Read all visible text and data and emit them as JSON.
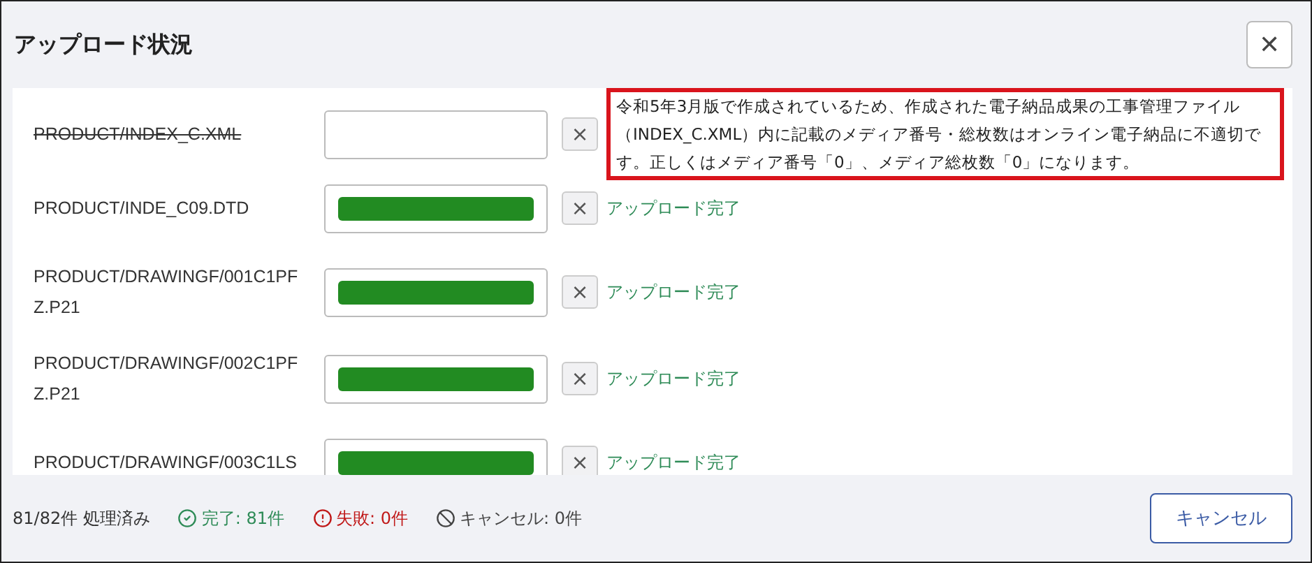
{
  "dialog": {
    "title": "アップロード状況",
    "close_label": "✕"
  },
  "files": [
    {
      "kind": "error",
      "name": "PRODUCT/INDEX_C.XML",
      "struck": true,
      "cancel_label": "×",
      "message": "令和5年3月版で作成されているため、作成された電子納品成果の工事管理ファイル（INDEX_C.XML）内に記載のメディア番号・総枚数はオンライン電子納品に不適切です。正しくはメディア番号「0」、メディア総枚数「0」になります。"
    },
    {
      "kind": "done",
      "name": "PRODUCT/INDE_C09.DTD",
      "struck": false,
      "cancel_label": "×",
      "message": "アップロード完了"
    },
    {
      "kind": "done",
      "name": "PRODUCT/DRAWINGF/001C1PFZ.P21",
      "struck": false,
      "cancel_label": "×",
      "message": "アップロード完了"
    },
    {
      "kind": "done",
      "name": "PRODUCT/DRAWINGF/002C1PFZ.P21",
      "struck": false,
      "cancel_label": "×",
      "message": "アップロード完了"
    },
    {
      "kind": "done",
      "name": "PRODUCT/DRAWINGF/003C1LS",
      "struck": false,
      "cancel_label": "×",
      "message": "アップロード完了"
    }
  ],
  "footer": {
    "processed": "81/82件 処理済み",
    "done": "完了: 81件",
    "failed": "失敗: 0件",
    "cancelled": "キャンセル: 0件",
    "cancel_button": "キャンセル"
  }
}
